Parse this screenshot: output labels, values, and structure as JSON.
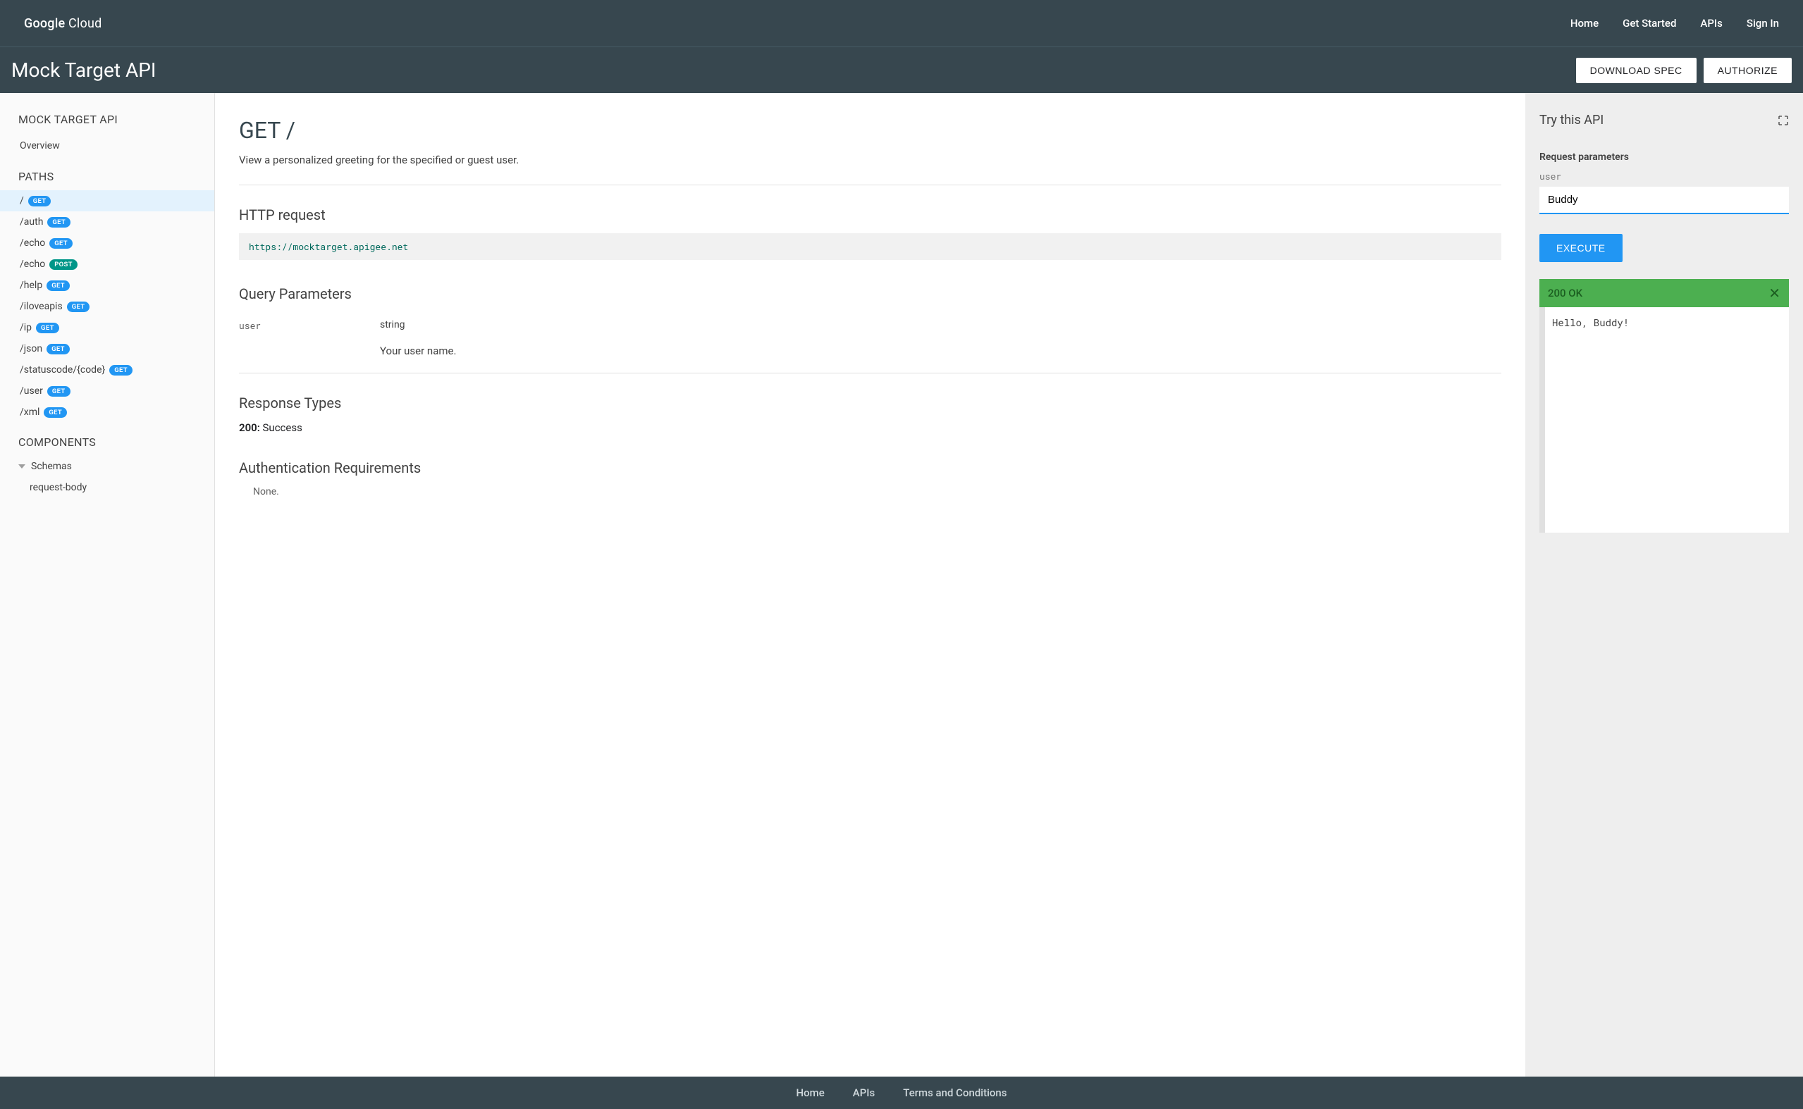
{
  "brand": {
    "part1": "Google",
    "part2": "Cloud"
  },
  "topnav": {
    "home": "Home",
    "getStarted": "Get Started",
    "apis": "APIs",
    "signIn": "Sign In"
  },
  "subbar": {
    "title": "Mock Target API",
    "download": "DOWNLOAD SPEC",
    "authorize": "AUTHORIZE"
  },
  "sidebar": {
    "apiHead": "MOCK TARGET API",
    "overview": "Overview",
    "pathsHead": "PATHS",
    "paths": [
      {
        "path": "/",
        "method": "GET",
        "active": true
      },
      {
        "path": "/auth",
        "method": "GET"
      },
      {
        "path": "/echo",
        "method": "GET"
      },
      {
        "path": "/echo",
        "method": "POST"
      },
      {
        "path": "/help",
        "method": "GET"
      },
      {
        "path": "/iloveapis",
        "method": "GET"
      },
      {
        "path": "/ip",
        "method": "GET"
      },
      {
        "path": "/json",
        "method": "GET"
      },
      {
        "path": "/statuscode/{code}",
        "method": "GET"
      },
      {
        "path": "/user",
        "method": "GET"
      },
      {
        "path": "/xml",
        "method": "GET"
      }
    ],
    "componentsHead": "COMPONENTS",
    "schemas": "Schemas",
    "schemaChild": "request-body"
  },
  "doc": {
    "title": "GET /",
    "desc": "View a personalized greeting for the specified or guest user.",
    "httpReqTitle": "HTTP request",
    "httpUrl": "https://mocktarget.apigee.net",
    "queryTitle": "Query Parameters",
    "param": {
      "name": "user",
      "type": "string",
      "desc": "Your user name."
    },
    "respTitle": "Response Types",
    "respCode": "200:",
    "respText": " Success",
    "authTitle": "Authentication Requirements",
    "authNone": "None."
  },
  "tryit": {
    "title": "Try this API",
    "reqParams": "Request parameters",
    "paramName": "user",
    "inputValue": "Buddy",
    "execute": "EXECUTE",
    "status": "200 OK",
    "response": "Hello, Buddy!"
  },
  "footer": {
    "home": "Home",
    "apis": "APIs",
    "terms": "Terms and Conditions"
  }
}
